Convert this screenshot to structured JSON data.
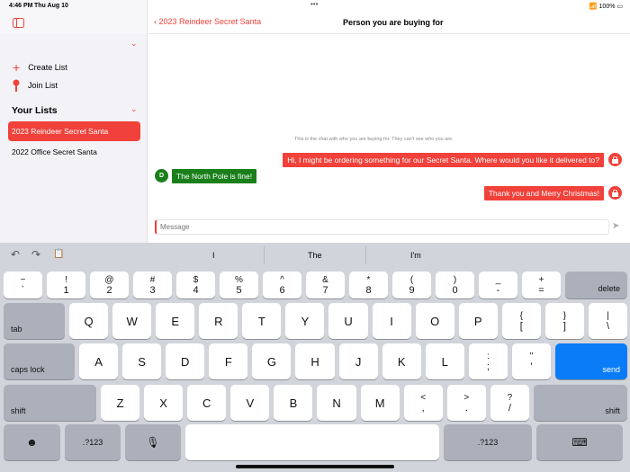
{
  "status": {
    "time": "4:46 PM",
    "date": "Thu Aug 10",
    "battery": "100%"
  },
  "sidebar": {
    "create": "Create List",
    "join": "Join List",
    "your_lists": "Your Lists",
    "lists": [
      "2023 Reindeer Secret Santa",
      "2022 Office Secret Santa"
    ]
  },
  "nav": {
    "back": "2023 Reindeer Secret Santa",
    "title": "Person you are buying for"
  },
  "chat": {
    "notice": "This is the chat with who you are buying for. They can't see who you are.",
    "m1": "Hi, I might be ordering something for our Secret Santa. Where would you like it delivered to?",
    "avatar": "D",
    "m2": "The North Pole is fine!",
    "m3": "Thank you and Merry Christmas!",
    "placeholder": "Message"
  },
  "suggestions": [
    "I",
    "The",
    "I'm"
  ],
  "keyboard": {
    "row1": [
      [
        "~",
        "`"
      ],
      [
        "!",
        "1"
      ],
      [
        "@",
        "2"
      ],
      [
        "#",
        "3"
      ],
      [
        "$",
        "4"
      ],
      [
        "%",
        "5"
      ],
      [
        "^",
        "6"
      ],
      [
        "&",
        "7"
      ],
      [
        "*",
        "8"
      ],
      [
        "(",
        "9"
      ],
      [
        ")",
        "0"
      ],
      [
        "_",
        "-"
      ],
      [
        "+",
        "="
      ]
    ],
    "row2": [
      "Q",
      "W",
      "E",
      "R",
      "T",
      "Y",
      "U",
      "I",
      "O",
      "P",
      [
        "{",
        "["
      ],
      [
        "}",
        "]"
      ],
      [
        "|",
        "\\"
      ]
    ],
    "row3": [
      "A",
      "S",
      "D",
      "F",
      "G",
      "H",
      "J",
      "K",
      "L",
      [
        ":",
        ";"
      ],
      [
        "\"",
        "'"
      ]
    ],
    "row4": [
      "Z",
      "X",
      "C",
      "V",
      "B",
      "N",
      "M",
      [
        "<",
        ","
      ],
      [
        ">",
        "."
      ],
      [
        "?",
        "/"
      ]
    ],
    "delete": "delete",
    "tab": "tab",
    "caps": "caps lock",
    "send": "send",
    "shift": "shift",
    "num": ".?123"
  },
  "colors": {
    "accent": "#f0413a",
    "green": "#1a7f1a",
    "send": "#0a7cf7"
  }
}
